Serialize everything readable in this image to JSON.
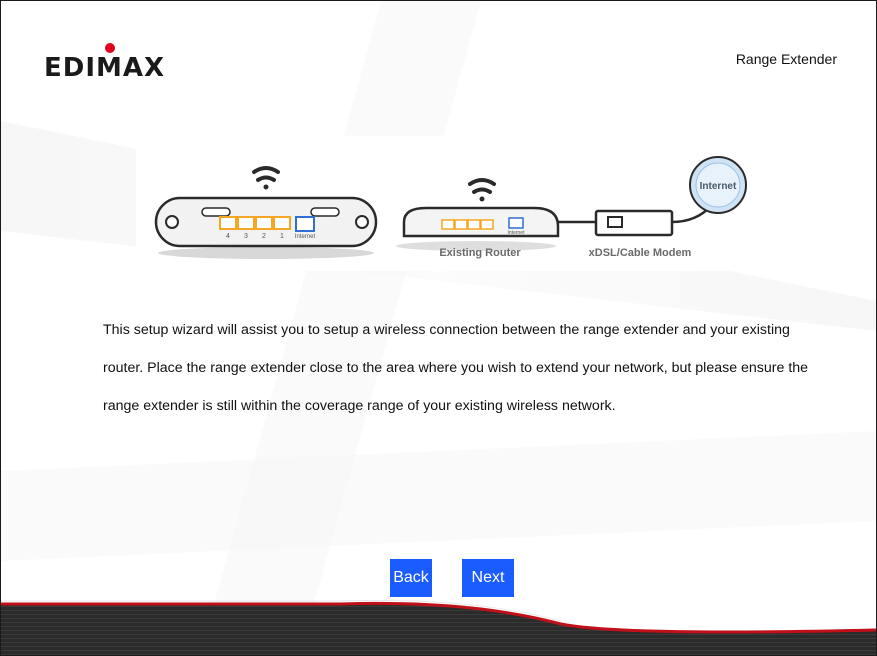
{
  "header": {
    "logo_text": "EDIMAX",
    "product_title": "Range Extender"
  },
  "diagram": {
    "existing_router_label": "Existing Router",
    "modem_label": "xDSL/Cable Modem",
    "internet_label": "Internet",
    "extender_port_numbers": [
      "4",
      "3",
      "2",
      "1"
    ],
    "extender_port_internet": "Internet",
    "router_port_internet": "Internet"
  },
  "main": {
    "description": "This setup wizard will assist you to setup a wireless connection between the range extender and your existing router. Place the range extender close to the area where you wish to extend your network, but please ensure the range extender is still within the coverage range of your existing wireless network."
  },
  "buttons": {
    "back_label": "Back",
    "next_label": "Next"
  },
  "colors": {
    "button_bg": "#1a5cff",
    "port_orange": "#f5a623",
    "port_blue": "#2f6fd6",
    "logo_dot": "#e0001b",
    "footer_red": "#c0101a"
  }
}
